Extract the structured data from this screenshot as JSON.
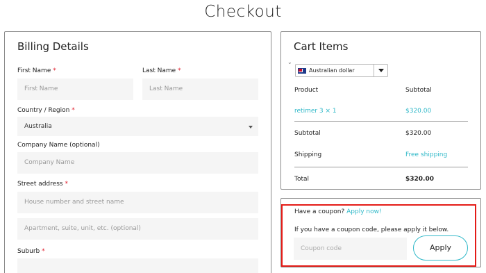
{
  "page": {
    "title": "Checkout"
  },
  "billing": {
    "heading": "Billing Details",
    "first_name_label": "First Name",
    "first_name_placeholder": "First Name",
    "last_name_label": "Last Name",
    "last_name_placeholder": "Last Name",
    "country_label": "Country / Region",
    "country_value": "Australia",
    "company_label": "Company Name (optional)",
    "company_placeholder": "Company Name",
    "street_label": "Street address",
    "street_placeholder": "House number and street name",
    "apartment_placeholder": "Apartment, suite, unit, etc. (optional)",
    "suburb_label": "Suburb",
    "required_mark": "*"
  },
  "cart": {
    "heading": "Cart Items",
    "currency": "Australian dollar",
    "product_header": "Product",
    "subtotal_header": "Subtotal",
    "item_name": "retimer 3  × 1",
    "item_price": "$320.00",
    "subtotal_label": "Subtotal",
    "subtotal_value": "$320.00",
    "shipping_label": "Shipping",
    "shipping_value": "Free shipping",
    "total_label": "Total",
    "total_value": "$320.00"
  },
  "coupon": {
    "prompt": "Have a coupon?",
    "link": "Apply now!",
    "instruction": "If you have a coupon code, please apply it below.",
    "input_placeholder": "Coupon code",
    "button_label": "Apply"
  },
  "colors": {
    "accent": "#2fb8c8",
    "required": "#e0202e",
    "highlight": "#e41b17"
  }
}
